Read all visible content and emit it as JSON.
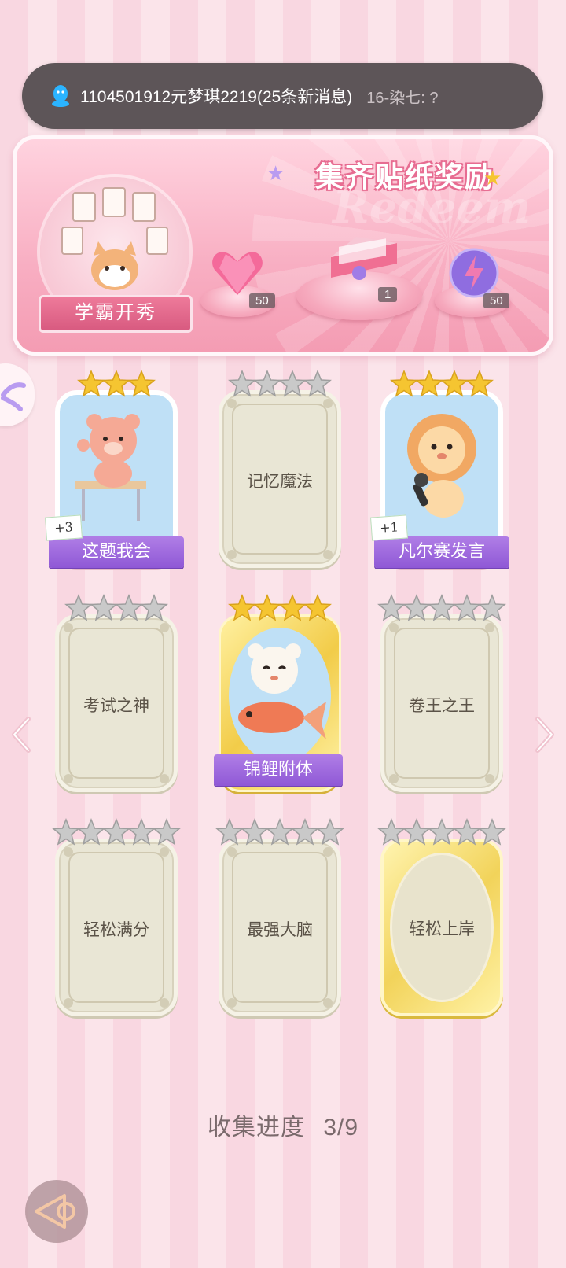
{
  "notification": {
    "message": "1104501912元梦琪2219(25条新消息)",
    "preview": "16-染七: ?"
  },
  "banner": {
    "title": "集齐贴纸奖励",
    "watermark": "Redeem",
    "badge_label": "学霸开秀",
    "rewards": [
      {
        "name": "heart-gem",
        "count": "50"
      },
      {
        "name": "gift-box",
        "count": "1"
      },
      {
        "name": "energy-orb",
        "count": "50"
      }
    ]
  },
  "stickers": [
    {
      "label": "这题我会",
      "stars": 3,
      "collected": true,
      "bonus": "+3",
      "style": "normal"
    },
    {
      "label": "记忆魔法",
      "stars": 4,
      "collected": false,
      "style": "normal"
    },
    {
      "label": "凡尔赛发言",
      "stars": 4,
      "collected": true,
      "bonus": "+1",
      "style": "normal"
    },
    {
      "label": "考试之神",
      "stars": 4,
      "collected": false,
      "style": "normal"
    },
    {
      "label": "锦鲤附体",
      "stars": 4,
      "collected": true,
      "style": "gold"
    },
    {
      "label": "卷王之王",
      "stars": 5,
      "collected": false,
      "style": "normal"
    },
    {
      "label": "轻松满分",
      "stars": 5,
      "collected": false,
      "style": "normal"
    },
    {
      "label": "最强大脑",
      "stars": 5,
      "collected": false,
      "style": "normal"
    },
    {
      "label": "轻松上岸",
      "stars": 5,
      "collected": false,
      "style": "gold"
    }
  ],
  "progress": {
    "label": "收集进度",
    "value": "3/9"
  },
  "colors": {
    "accent_pink": "#f49cb3",
    "label_purple": "#8f58d6",
    "star_gold": "#f5c531",
    "star_gray": "#c9c9c9"
  }
}
